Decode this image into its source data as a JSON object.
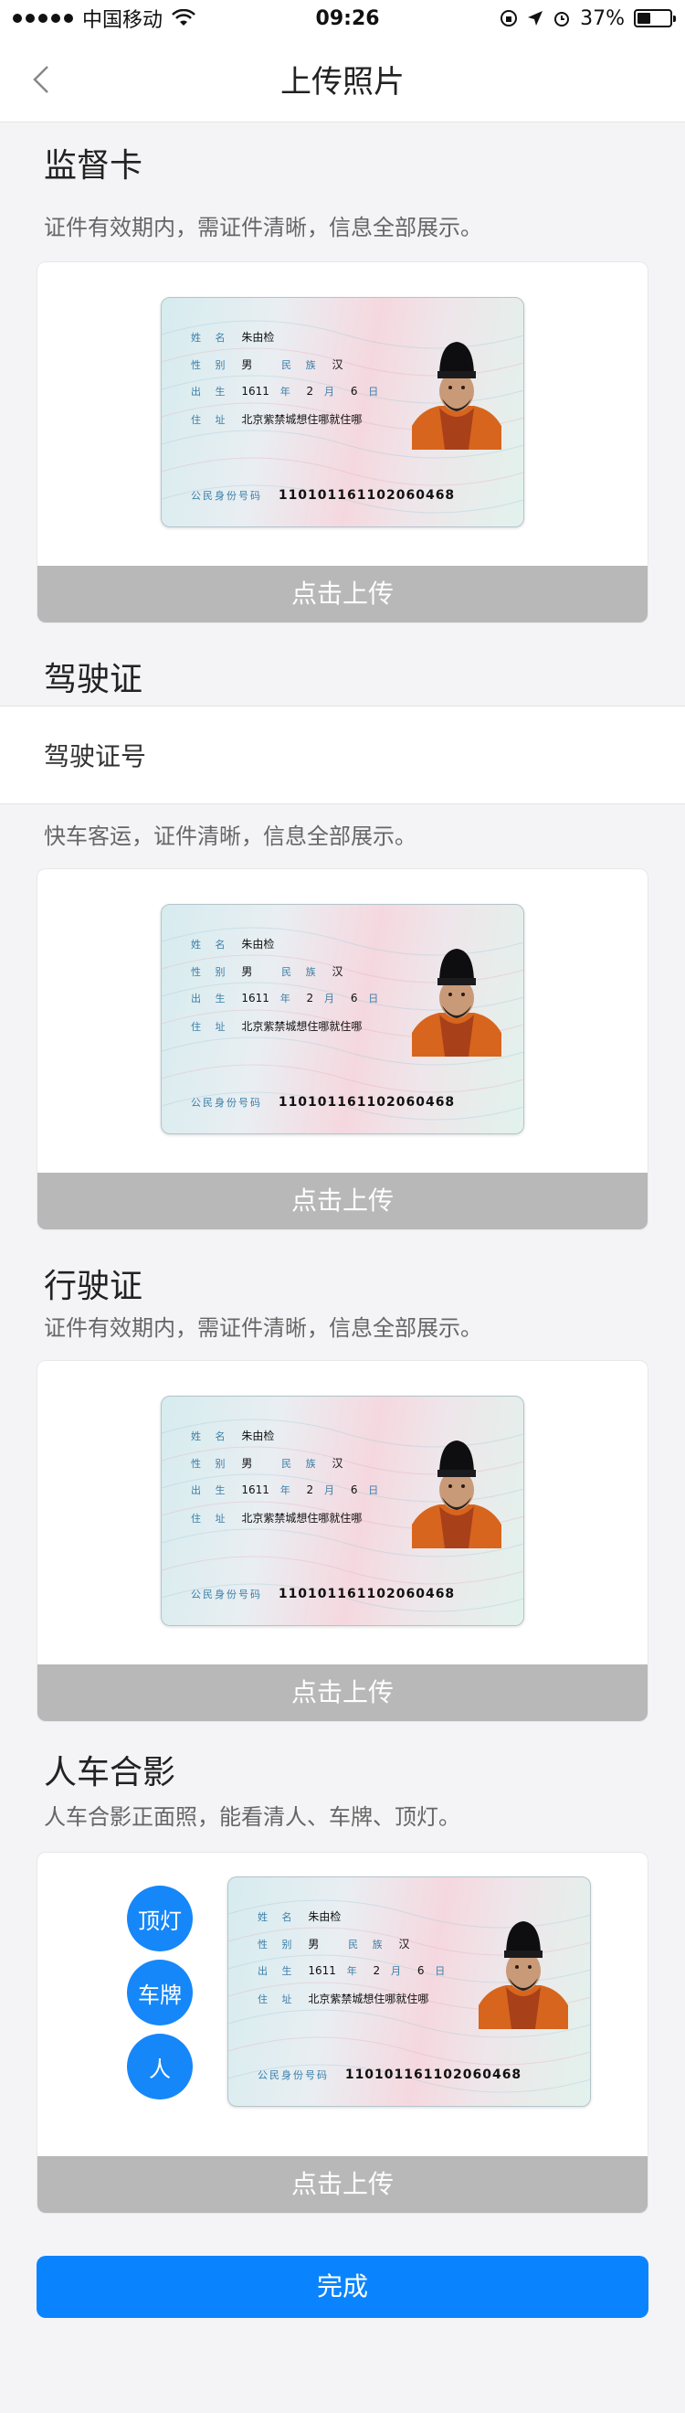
{
  "status_bar": {
    "carrier": "中国移动",
    "time": "09:26",
    "battery": "37%"
  },
  "nav": {
    "title": "上传照片"
  },
  "id_card_sample": {
    "name_label": "姓 名",
    "name": "朱由检",
    "gender_label": "性 别",
    "gender": "男",
    "ethnic_label": "民 族",
    "ethnic": "汉",
    "birth_label": "出 生",
    "birth_year": "1611",
    "birth_year_unit": "年",
    "birth_month": "2",
    "birth_month_unit": "月",
    "birth_day": "6",
    "birth_day_unit": "日",
    "address_label": "住 址",
    "address": "北京紫禁城想住哪就住哪",
    "id_label": "公民身份号码",
    "id_number": "110101161102060468"
  },
  "sections": {
    "supervision": {
      "title": "监督卡",
      "desc": "证件有效期内，需证件清晰，信息全部展示。",
      "upload_label": "点击上传"
    },
    "license": {
      "title": "驾驶证",
      "field_label": "驾驶证号",
      "desc": "快车客运，证件清晰，信息全部展示。",
      "upload_label": "点击上传"
    },
    "vehicle": {
      "title": "行驶证",
      "desc": "证件有效期内，需证件清晰，信息全部展示。",
      "upload_label": "点击上传"
    },
    "group_photo": {
      "title": "人车合影",
      "desc": "人车合影正面照，能看清人、车牌、顶灯。",
      "chips": [
        "顶灯",
        "车牌",
        "人"
      ],
      "upload_label": "点击上传"
    }
  },
  "done_label": "完成",
  "colors": {
    "accent": "#0a84fe",
    "chip": "#1587f9",
    "upload_bar": "#b8b8b8"
  }
}
